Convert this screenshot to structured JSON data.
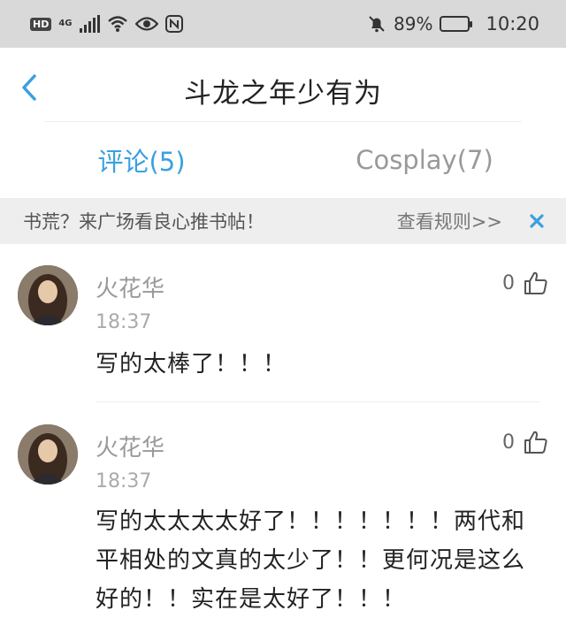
{
  "status_bar": {
    "hd": "HD",
    "network": "4G",
    "battery_percent": "89%",
    "battery_level": 0.89,
    "time": "10:20"
  },
  "header": {
    "title": "斗龙之年少有为"
  },
  "tabs": [
    {
      "label": "评论(5)",
      "active": true
    },
    {
      "label": "Cosplay(7)",
      "active": false
    }
  ],
  "notice": {
    "text": "书荒？来广场看良心推书帖！",
    "link": "查看规则>>"
  },
  "comments": [
    {
      "author": "火花华",
      "time": "18:37",
      "likes": "0",
      "body": "写的太棒了！！！"
    },
    {
      "author": "火花华",
      "time": "18:37",
      "likes": "0",
      "body": "写的太太太太好了！！！！！！！两代和平相处的文真的太少了！！更何况是这么好的！！实在是太好了！！！"
    }
  ],
  "colors": {
    "accent": "#3aa0e0",
    "status_bar_bg": "#d9d9d9",
    "notice_bg": "#eeeeee"
  }
}
